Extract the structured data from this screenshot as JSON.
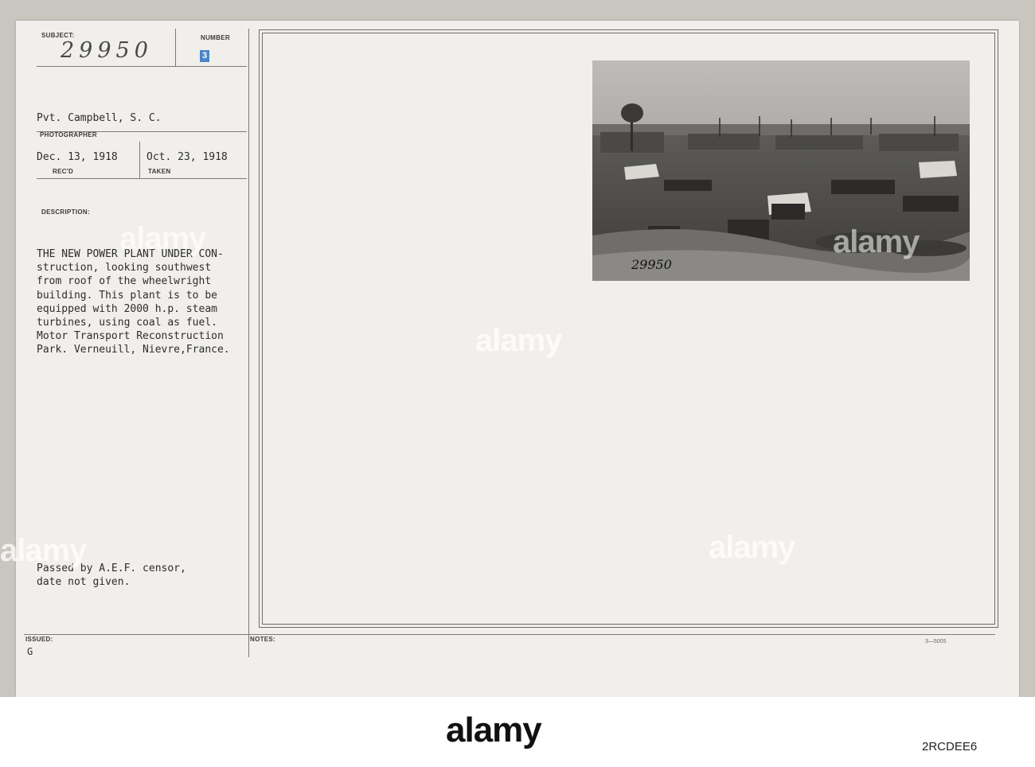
{
  "card": {
    "subject_label": "SUBJECT:",
    "subject_value": "29950",
    "number_label": "NUMBER",
    "number_value": "3",
    "photographer_name": "Pvt. Campbell, S. C.",
    "photographer_label": "PHOTOGRAPHER",
    "recd_value": "Dec. 13, 1918",
    "recd_label": "REC'D",
    "taken_value": "Oct. 23, 1918",
    "taken_label": "TAKEN",
    "description_label": "DESCRIPTION:",
    "description_lines": [
      "THE NEW POWER PLANT UNDER CON-",
      "struction, looking southwest",
      "from roof of the wheelwright",
      "building. This plant is to be",
      "equipped with 2000 h.p. steam",
      "turbines, using coal as fuel.",
      "Motor Transport Reconstruction",
      "Park. Verneuill, Nievre,France."
    ],
    "censor_lines": [
      "Passed by A.E.F. censor,",
      "date not given."
    ],
    "issued_label": "ISSUED:",
    "issued_value": "G",
    "notes_label": "NOTES:",
    "form_code": "3—5005",
    "photo_number": "29950"
  },
  "watermark": "alamy",
  "footer": {
    "logo": "alamy",
    "stock_id": "2RCDEE6"
  },
  "colors": {
    "card": "#f1efec",
    "stamp": "#4a86c7",
    "lines": "#7d7b78"
  }
}
